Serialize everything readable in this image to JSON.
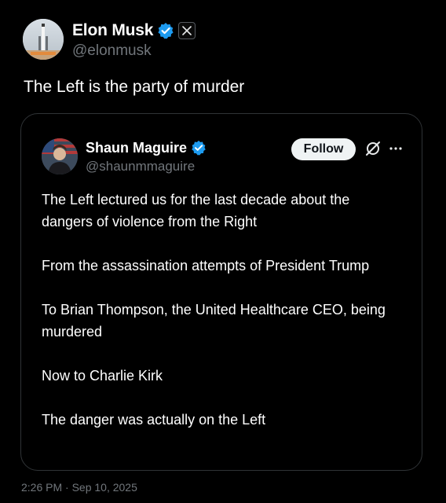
{
  "post": {
    "author": {
      "name": "Elon Musk",
      "handle": "@elonmusk"
    },
    "text": "The Left is the party of murder",
    "timestamp": "2:26 PM · Sep 10, 2025"
  },
  "quote": {
    "author": {
      "name": "Shaun Maguire",
      "handle": "@shaunmmaguire"
    },
    "follow_label": "Follow",
    "paragraphs": [
      "The Left lectured us for the last decade about the dangers of violence from the Right",
      "From the assassination attempts of President Trump",
      "To Brian Thompson, the United Healthcare CEO, being murdered",
      "Now to Charlie Kirk",
      "The danger was actually on the Left"
    ]
  },
  "icons": {
    "verified": "verified-badge-icon",
    "affiliate": "x-logo-icon",
    "grok": "grok-icon",
    "more": "more-options-icon"
  },
  "colors": {
    "background": "#000000",
    "text_primary": "#ffffff",
    "text_secondary": "#71767b",
    "verified_blue": "#1d9bf0",
    "card_border": "#2f3336",
    "follow_bg": "#eff3f4"
  }
}
